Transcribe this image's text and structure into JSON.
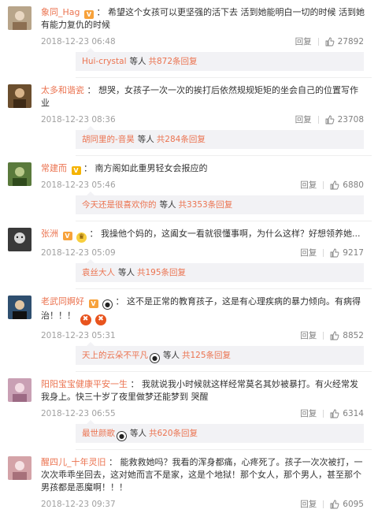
{
  "actions": {
    "reply_label": "回复"
  },
  "comments": [
    {
      "user": "象同_Hag",
      "text": "希望这个女孩可以更坚强的活下去 活到她能明白一切的时候 活到她有能力复仇的时候",
      "time": "2018-12-23 06:48",
      "likes": "27892",
      "avatar_color": "#b8a58a",
      "reply": {
        "name": "Hui-crystal",
        "mid": "等人",
        "count": "共872条回复"
      }
    },
    {
      "user": "太多和谐瓷",
      "text": "想哭，女孩子一次一次的挨打后依然规规矩矩的坐会自己的位置写作业",
      "time": "2018-12-23 08:36",
      "likes": "23708",
      "avatar_color": "#6b4e2e",
      "reply": {
        "name": "胡同里的-音昊",
        "mid": "等人",
        "count": "共284条回复"
      }
    },
    {
      "user": "常建而",
      "text": "南方阁如此重男轻女会报应的",
      "time": "2018-12-23 05:46",
      "likes": "6880",
      "avatar_color": "#5a7a3c",
      "reply": {
        "name": "今天还是很喜欢你的",
        "mid": "等人",
        "count": "共3353条回复"
      }
    },
    {
      "user": "张洲",
      "text": "我操他个妈的，这阖女一看就很懂事啊，为什么这样？好想领养她...",
      "time": "2018-12-23 05:09",
      "likes": "9217",
      "avatar_color": "#3a3a3a",
      "reply": {
        "name": "袁丝大人",
        "mid": "等人",
        "count": "共195条回复"
      }
    },
    {
      "user": "老武同婀好",
      "text": "这不是正常的教育孩子，这是有心理疾病的暴力倾向。有病得治！！！",
      "time": "2018-12-23 05:31",
      "likes": "8852",
      "avatar_color": "#2f4f6f",
      "reply": {
        "name": "天上的云朵不平凡",
        "mid": "等人",
        "count": "共125条回复"
      }
    },
    {
      "user": "阳阳宝宝健康平安一生",
      "text": "我就说我小时候就这样经常莫名其妙被暴打。有火经常发我身上。快三十岁了夜里做梦还能梦到 哭醒",
      "time": "2018-12-23 06:55",
      "likes": "6314",
      "avatar_color": "#c9a0b4",
      "reply": {
        "name": "最世颜歌",
        "mid": "等人",
        "count": "共620条回复"
      }
    },
    {
      "user": "醒四儿_十年灵旧",
      "text": "能救救她吗？我看的浑身都痛，心疼死了。孩子一次次被打，一次次乖乖坐回去，这对她而言不是家，这是个地狱！那个女人，那个男人，甚至那个男孩都是恶魔啊！！！",
      "time": "2018-12-23 09:37",
      "likes": "6095",
      "avatar_color": "#d4a3a8",
      "reply": null
    }
  ]
}
